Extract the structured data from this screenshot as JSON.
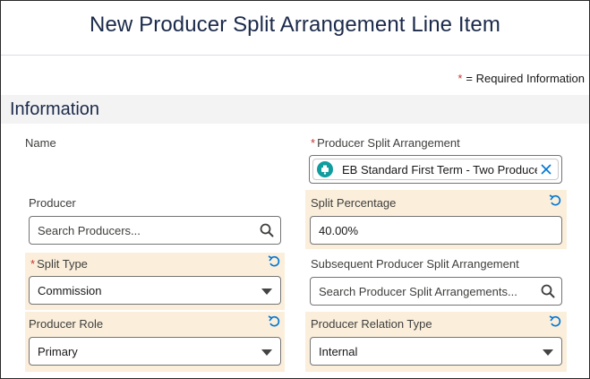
{
  "header": {
    "title": "New Producer Split Arrangement Line Item"
  },
  "required_note": {
    "star": "*",
    "text": "= Required Information"
  },
  "section": {
    "title": "Information"
  },
  "fields": {
    "name": {
      "label": "Name"
    },
    "producer_split_arrangement": {
      "required": "*",
      "label": "Producer Split Arrangement",
      "value": "EB Standard First Term - Two Producers"
    },
    "producer": {
      "label": "Producer",
      "placeholder": "Search Producers..."
    },
    "split_percentage": {
      "label": "Split Percentage",
      "value": "40.00%"
    },
    "split_type": {
      "required": "*",
      "label": "Split Type",
      "value": "Commission"
    },
    "subsequent_arrangement": {
      "label": "Subsequent Producer Split Arrangement",
      "placeholder": "Search Producer Split Arrangements..."
    },
    "producer_role": {
      "label": "Producer Role",
      "value": "Primary"
    },
    "producer_relation_type": {
      "label": "Producer Relation Type",
      "value": "Internal"
    }
  },
  "icons": {
    "search": "search-icon",
    "undo": "undo-icon",
    "remove": "close-icon",
    "object": "producer-split-arrangement-icon",
    "dropdown": "chevron-down-icon"
  },
  "colors": {
    "highlight": "#fbefdc",
    "accent": "#0176d3",
    "required": "#c23934",
    "title": "#1b2a4a"
  }
}
